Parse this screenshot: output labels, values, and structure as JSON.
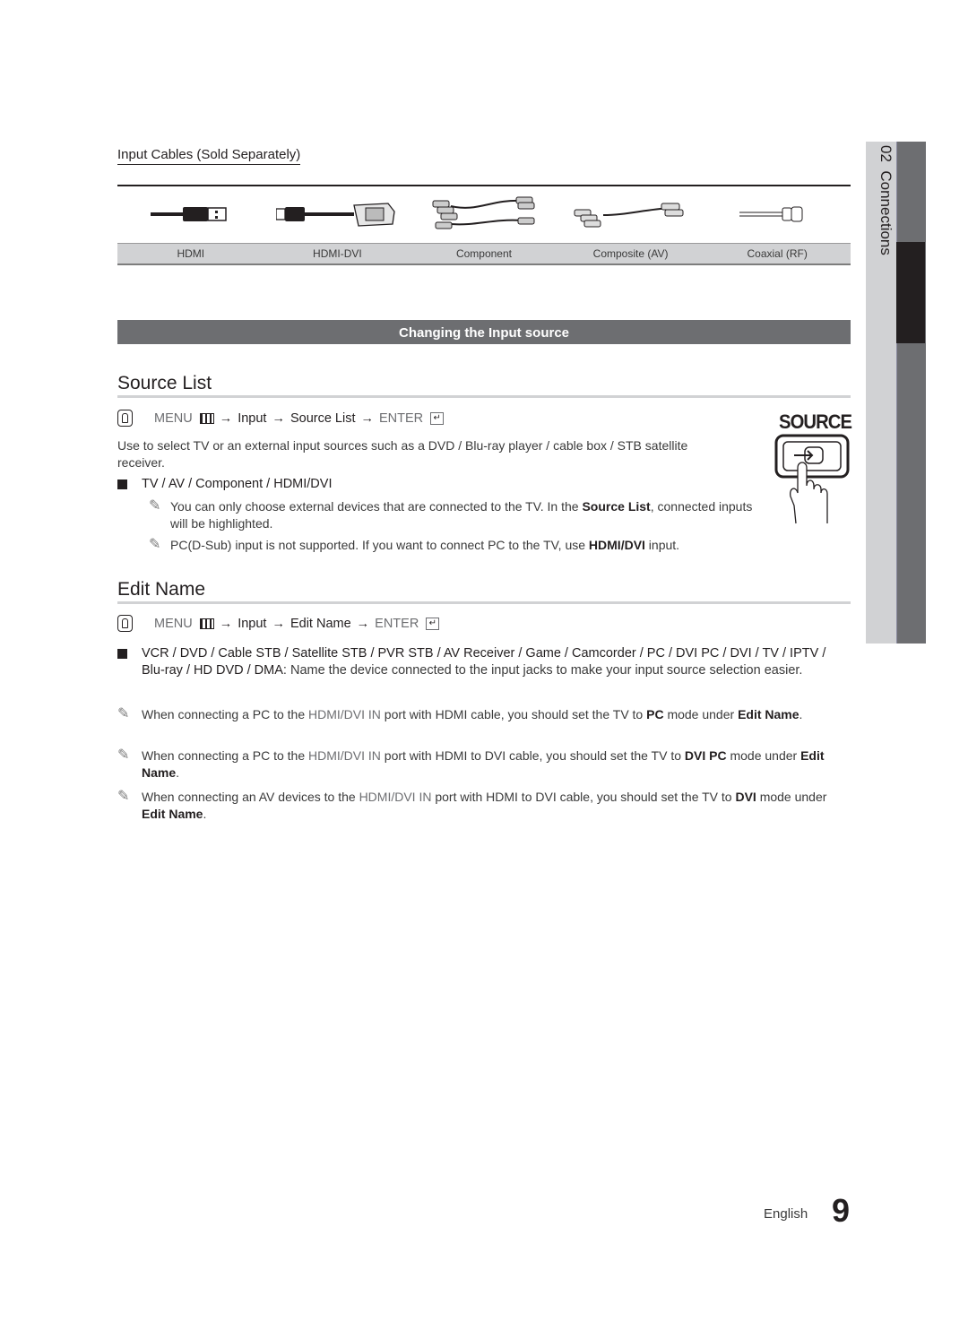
{
  "side_tab": {
    "number": "02",
    "label": "Connections"
  },
  "cables": {
    "title": "Input Cables (Sold Separately)",
    "items": [
      {
        "label": "HDMI",
        "icon": "hdmi-cable-icon"
      },
      {
        "label": "HDMI-DVI",
        "icon": "hdmi-dvi-cable-icon"
      },
      {
        "label": "Component",
        "icon": "component-cable-icon"
      },
      {
        "label": "Composite (AV)",
        "icon": "composite-cable-icon"
      },
      {
        "label": "Coaxial (RF)",
        "icon": "coaxial-cable-icon"
      }
    ]
  },
  "section_bar": "Changing the Input source",
  "source_list": {
    "heading": "Source List",
    "menu_path": {
      "menu": "MENU",
      "arrow": "→",
      "step1": "Input",
      "step2": "Source List",
      "enter": "ENTER"
    },
    "description": "Use to select TV or an external input sources such as a DVD / Blu-ray player / cable box / STB satellite receiver.",
    "bullet": "TV / AV / Component / HDMI/DVI",
    "notes": [
      {
        "pre": "You can only choose external devices that are connected to the TV. In the ",
        "strong": "Source List",
        "post": ", connected inputs will be highlighted."
      },
      {
        "pre": "PC(D-Sub) input is not supported. If you want to connect PC to the TV, use ",
        "strong": "HDMI/DVI",
        "post": " input."
      }
    ],
    "button_label": "SOURCE"
  },
  "edit_name": {
    "heading": "Edit Name",
    "menu_path": {
      "menu": "MENU",
      "arrow": "→",
      "step1": "Input",
      "step2": "Edit Name",
      "enter": "ENTER"
    },
    "bullet_strong": "VCR / DVD / Cable STB / Satellite STB / PVR STB / AV Receiver / Game / Camcorder / PC / DVI PC / DVI / TV / IPTV / Blu-ray / HD DVD / DMA",
    "bullet_text": ": Name the device connected to the input jacks to make your input source selection easier.",
    "notes": [
      {
        "a": "When connecting a PC to the ",
        "port": "HDMI/DVI IN",
        "b": " port with HDMI cable, you should set the TV to ",
        "mode": "PC",
        "c": " mode under ",
        "menu": "Edit Name",
        "d": "."
      },
      {
        "a": "When connecting a PC to the ",
        "port": "HDMI/DVI IN",
        "b": " port with HDMI to DVI cable, you should set the TV to ",
        "mode": "DVI PC",
        "c": " mode under ",
        "menu": "Edit Name",
        "d": "."
      },
      {
        "a": "When connecting an AV devices to the ",
        "port": "HDMI/DVI IN",
        "b": " port with HDMI to DVI cable, you should set the TV to ",
        "mode": "DVI",
        "c": " mode under ",
        "menu": "Edit Name",
        "d": "."
      }
    ]
  },
  "footer": {
    "language": "English",
    "page_number": "9"
  },
  "colors": {
    "section_bar": "#6d6e71",
    "side_tab_active": "#231f20",
    "side_tab_light": "#d1d2d4",
    "accent_grey": "#6d6e71"
  }
}
